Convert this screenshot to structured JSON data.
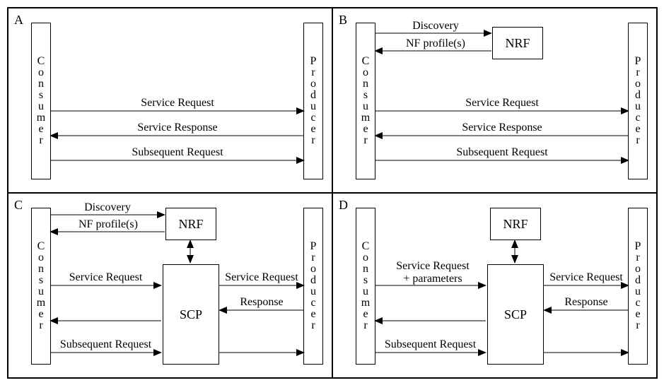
{
  "panels": {
    "a": {
      "label": "A",
      "consumer": "Consumer",
      "producer": "Producer",
      "msgs": {
        "req": "Service Request",
        "resp": "Service Response",
        "sub": "Subsequent Request"
      }
    },
    "b": {
      "label": "B",
      "consumer": "Consumer",
      "producer": "Producer",
      "nrf": "NRF",
      "disc": "Discovery",
      "prof": "NF profile(s)",
      "msgs": {
        "req": "Service Request",
        "resp": "Service Response",
        "sub": "Subsequent Request"
      }
    },
    "c": {
      "label": "C",
      "consumer": "Consumer",
      "producer": "Producer",
      "nrf": "NRF",
      "scp": "SCP",
      "disc": "Discovery",
      "prof": "NF profile(s)",
      "msgs": {
        "req1": "Service Request",
        "req2": "Service Request",
        "resp": "Response",
        "sub": "Subsequent Request"
      }
    },
    "d": {
      "label": "D",
      "consumer": "Consumer",
      "producer": "Producer",
      "nrf": "NRF",
      "scp": "SCP",
      "msgs": {
        "req1": "Service Request\n+ parameters",
        "req2": "Service Request",
        "resp": "Response",
        "sub": "Subsequent Request"
      }
    }
  }
}
